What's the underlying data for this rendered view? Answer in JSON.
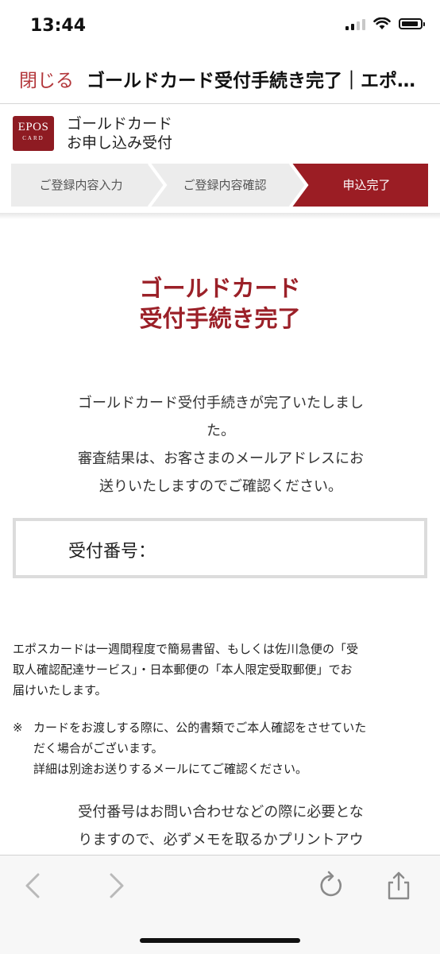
{
  "status_bar": {
    "time": "13:44"
  },
  "nav": {
    "close_label": "閉じる",
    "title": "ゴールドカード受付手続き完了｜エポ…"
  },
  "brand": {
    "logo_top": "EPOS",
    "logo_bottom": "CARD",
    "title_line1": "ゴールドカード",
    "title_line2": "お申し込み受付"
  },
  "steps": [
    {
      "label": "ご登録内容入力",
      "active": false
    },
    {
      "label": "ご登録内容確認",
      "active": false
    },
    {
      "label": "申込完了",
      "active": true
    }
  ],
  "main": {
    "heading_line1": "ゴールドカード",
    "heading_line2": "受付手続き完了",
    "para_line1": "ゴールドカード受付手続きが完了いたしまし",
    "para_line2": "た。",
    "para_line3": "審査結果は、お客さまのメールアドレスにお",
    "para_line4": "送りいたしますのでご確認ください。",
    "receipt_label": "受付番号：",
    "delivery_line1": "エポスカードは一週間程度で簡易書留、もしくは佐川急便の「受",
    "delivery_line2": "取人確認配達サービス」・日本郵便の「本人限定受取郵便」でお",
    "delivery_line3": "届けいたします。",
    "note_mark": "※",
    "note_line1": "カードをお渡しする際に、公的書類でご本人確認をさせていた",
    "note_line2": "だく場合がございます。",
    "note_line3": "詳細は別途お送りするメールにてご確認ください。",
    "memo_line1": "受付番号はお問い合わせなどの際に必要とな",
    "memo_line2": "りますので、必ずメモを取るかプリントアウ"
  },
  "colors": {
    "accent": "#9b2028",
    "close_text": "#b3373b",
    "step_inactive": "#ececec",
    "step_active": "#9b1d24"
  },
  "toolbar": {
    "icons": [
      "back-arrow-icon",
      "forward-arrow-icon",
      "reload-icon",
      "share-icon"
    ]
  }
}
